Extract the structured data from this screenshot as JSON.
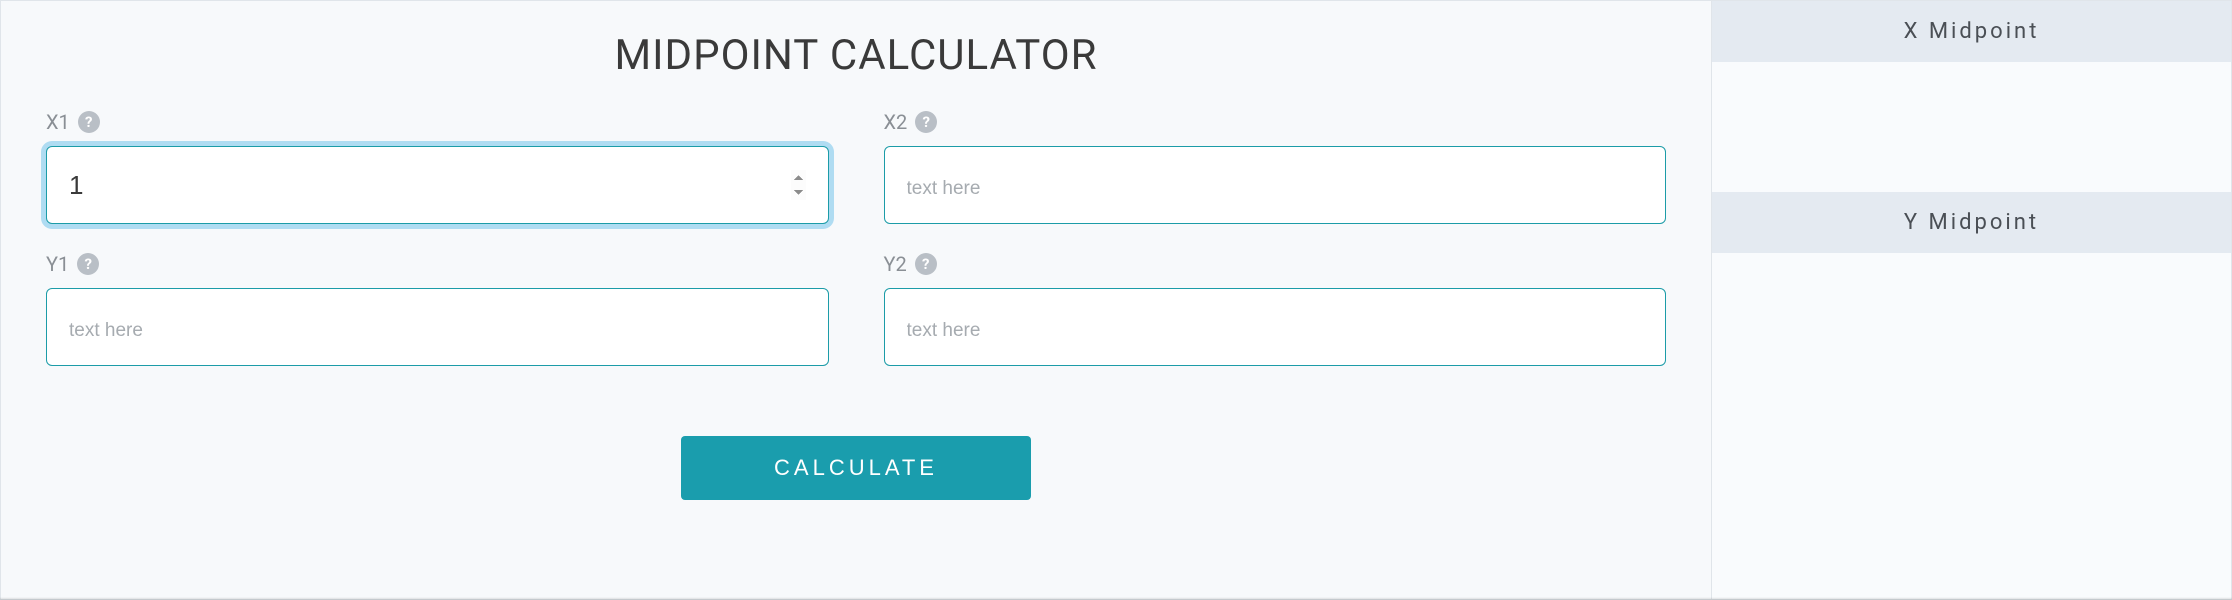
{
  "title": "MIDPOINT CALCULATOR",
  "fields": {
    "x1": {
      "label": "X1",
      "value": "1",
      "placeholder": "text here"
    },
    "x2": {
      "label": "X2",
      "value": "",
      "placeholder": "text here"
    },
    "y1": {
      "label": "Y1",
      "value": "",
      "placeholder": "text here"
    },
    "y2": {
      "label": "Y2",
      "value": "",
      "placeholder": "text here"
    }
  },
  "help_glyph": "?",
  "calculate_label": "CALCULATE",
  "results": {
    "x_label": "X Midpoint",
    "x_value": "",
    "y_label": "Y Midpoint",
    "y_value": ""
  },
  "colors": {
    "accent": "#1a9dad",
    "input_border": "#1c9ca8",
    "focus_ring": "rgba(86,185,231,0.45)",
    "bg_main": "#f7f9fb",
    "bg_side_header": "#e4eaf1"
  }
}
